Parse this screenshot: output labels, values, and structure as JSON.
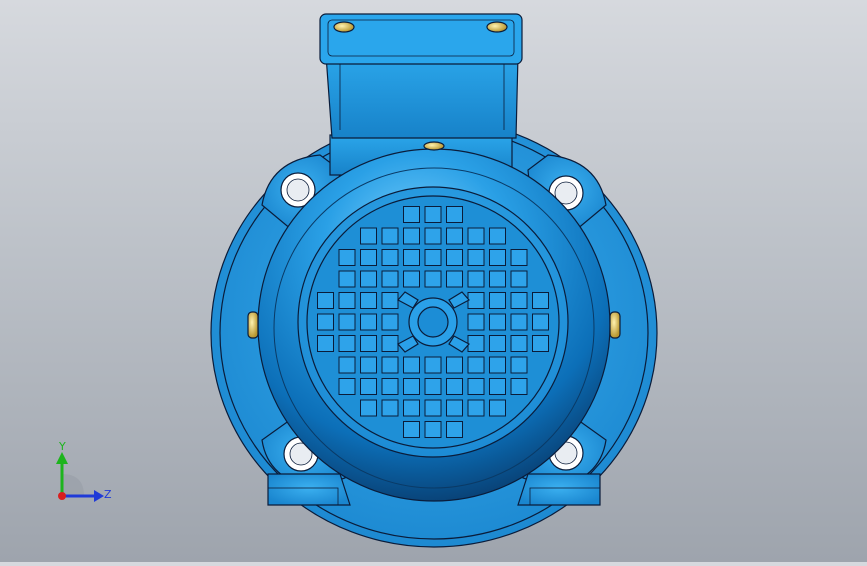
{
  "viewport": {
    "background_top": "#d6d9de",
    "background_bottom": "#9ea4ad",
    "model_color": "#1e90d8",
    "model_edge_color": "#0a1c3a"
  },
  "triad": {
    "y_label": "Y",
    "z_label": "Z",
    "y_color": "#1db41d",
    "z_color": "#1f3ad8",
    "x_color": "#d81f1f"
  }
}
